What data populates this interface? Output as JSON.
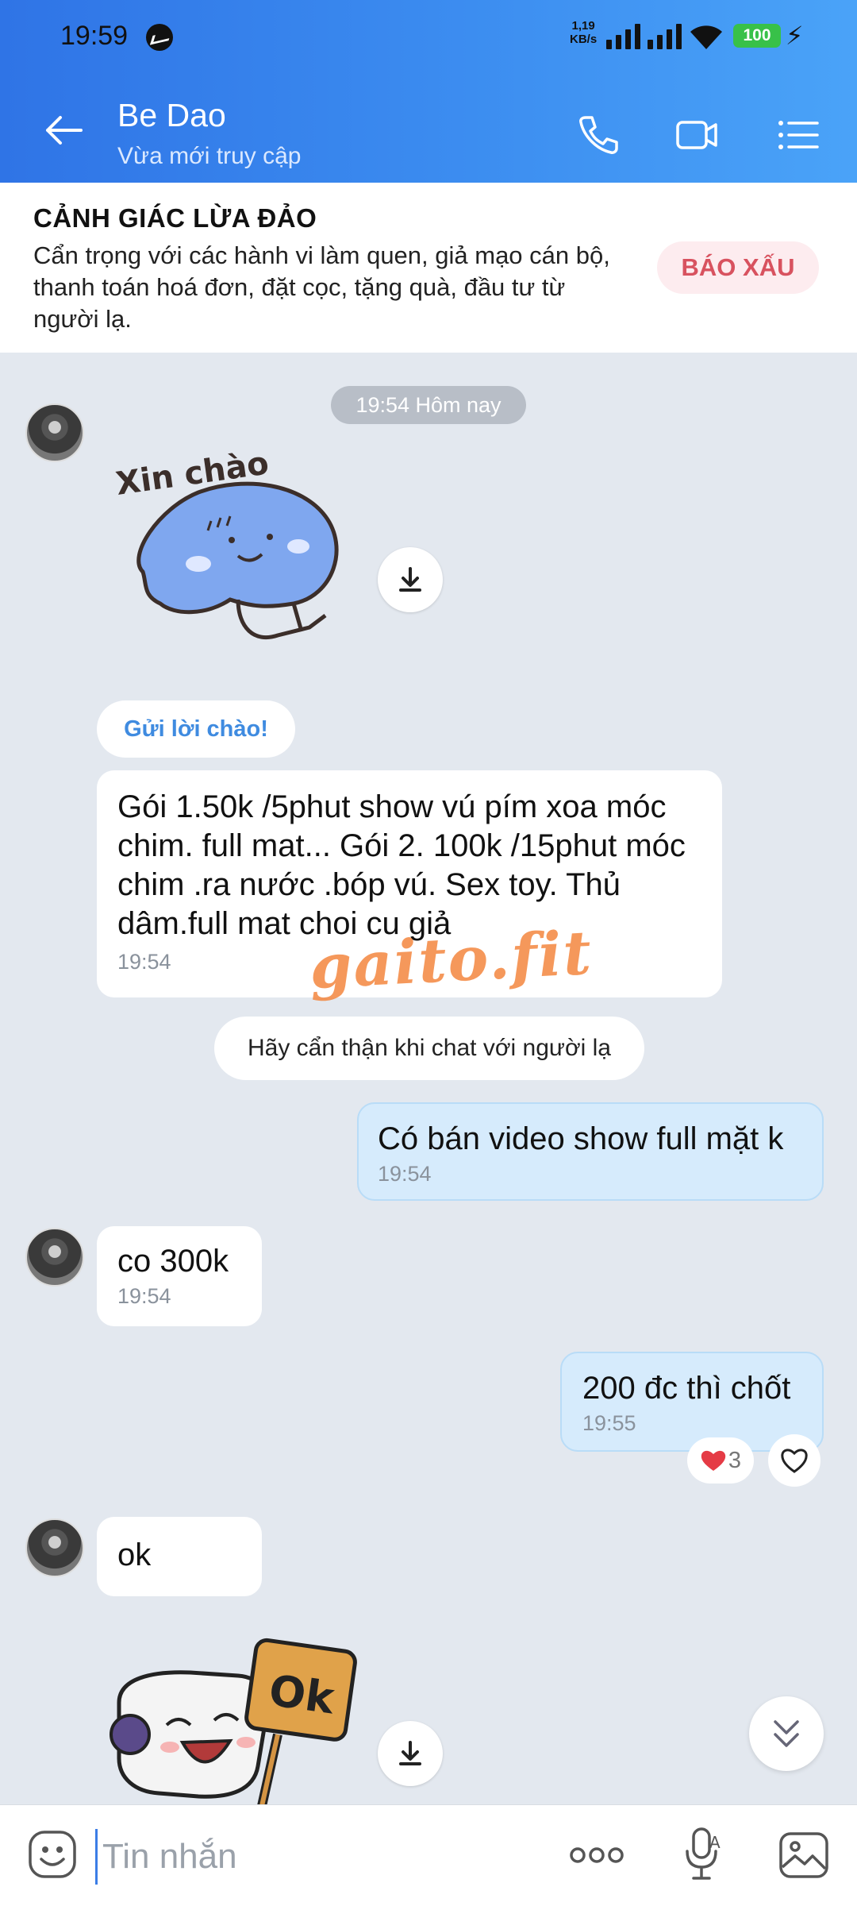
{
  "status_bar": {
    "time": "19:59",
    "net_speed_value": "1,19",
    "net_speed_unit": "KB/s",
    "battery": "100"
  },
  "header": {
    "contact_name": "Be Dao",
    "contact_status": "Vừa mới truy cập",
    "icons": [
      "back-arrow-icon",
      "phone-icon",
      "video-call-icon",
      "menu-list-icon"
    ]
  },
  "warning": {
    "title": "CẢNH GIÁC LỪA ĐẢO",
    "body": "Cẩn trọng với các hành vi làm quen, giả mạo cán bộ, thanh toán hoá đơn, đặt cọc, tặng quà, đầu tư từ người lạ.",
    "report_button": "BÁO XẤU"
  },
  "chat": {
    "time_chip": "19:54 Hôm nay",
    "sticker_greeting_text": "Xin chào",
    "greet_button": "Gửi lời chào!",
    "messages": [
      {
        "from": "them",
        "text": "Gói 1.50k /5phut show vú pím xoa móc chim. full mat... Gói 2. 100k /15phut móc chim .ra nước .bóp vú. Sex toy. Thủ dâm.full mat  choi cu giả",
        "time": "19:54"
      },
      {
        "from": "me",
        "text": "Có bán video show full mặt k",
        "time": "19:54"
      },
      {
        "from": "them",
        "text": "co 300k",
        "time": "19:54"
      },
      {
        "from": "me",
        "text": "200 đc thì chốt",
        "time": "19:55"
      },
      {
        "from": "them",
        "text": "ok",
        "time": ""
      }
    ],
    "notice": "Hãy cẩn thận khi chat với người lạ",
    "reaction_count": "3",
    "sticker_ok_text": "Ok",
    "watermark": "gaito.fit"
  },
  "input": {
    "placeholder": "Tin nhắn"
  },
  "colors": {
    "header_start": "#2f74e6",
    "header_end": "#4aa3f8",
    "my_bubble": "#d6ebfc",
    "report_text": "#d8525f"
  }
}
